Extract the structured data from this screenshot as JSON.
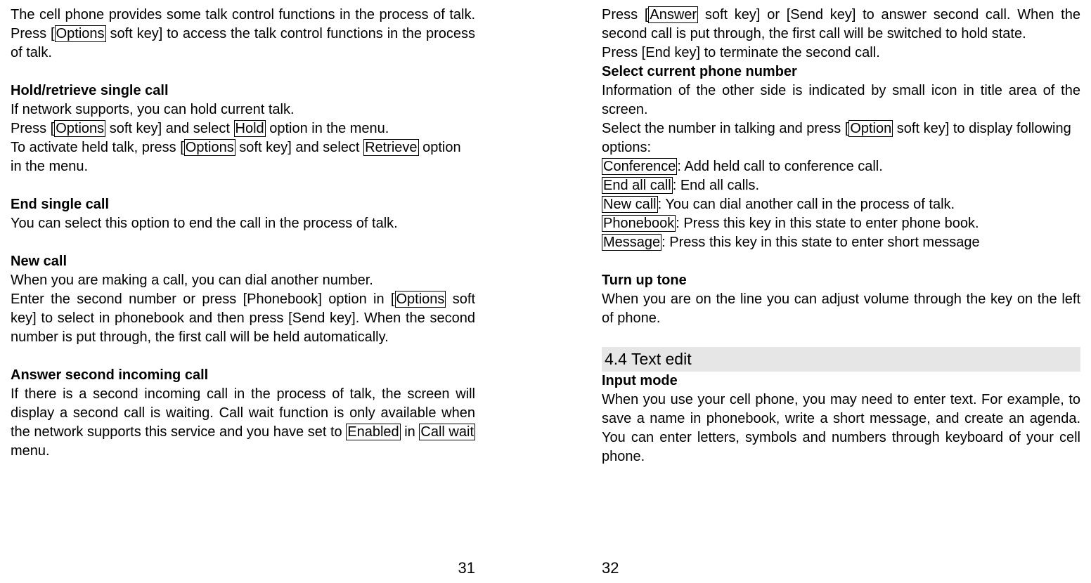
{
  "left": {
    "p1a": "The cell phone provides some talk control functions in the process of talk. Press [",
    "p1b": " soft key] to access the talk control functions in the process of talk.",
    "h1": "Hold/retrieve single call",
    "p2": "If network supports, you can hold current talk.",
    "p3a": "Press [",
    "p3b": " soft key] and select ",
    "p3c": " option in the menu.",
    "p4a": "To activate held talk, press [",
    "p4b": " soft key] and select ",
    "p4c": " option in the menu.",
    "h2": "End single call",
    "p5": "You can select this option to end the call in the process of talk.",
    "h3": "New call",
    "p6": "When you are making a call, you can dial another number.",
    "p7a": "Enter the second number or press [Phonebook] option in [",
    "p7b": " soft key] to select in phonebook and then press [Send key]. When the second number is put through, the first call will be held automatically.",
    "h4": "Answer second incoming call",
    "p8a": "If there is a second incoming call in the process of talk, the screen will display a second call is waiting. Call wait function is only available when the network supports this service and you have set to ",
    "p8b": " in ",
    "p8c": " menu.",
    "box_options": "Options",
    "box_hold": "Hold",
    "box_retrieve": "Retrieve",
    "box_enabled": "Enabled",
    "box_callwait": "Call wait",
    "pagenum": "31"
  },
  "right": {
    "p1a": "Press [",
    "p1b": " soft key] or [Send key] to answer second call. When the second call is put through, the first call will be switched to hold state.",
    "p2": "Press [End key] to terminate the second call.",
    "h1": "Select current phone number",
    "p3": "Information of the other side is indicated by small icon in title area of the screen.",
    "p4a": "Select the number in talking and press [",
    "p4b": " soft key] to display following options:",
    "opt1a": ": Add held call to conference call.",
    "opt2a": ": End all calls.",
    "opt3a": ": You can dial another call in the process of talk.",
    "opt4a": ": Press this key in this state to enter phone book.",
    "opt5a": ": Press this key in this state to enter short message",
    "h2": "Turn up tone",
    "p5": "When you are on the line you can adjust volume through the key on the left of phone.",
    "h3": "4.4 Text edit",
    "h4": "Input mode",
    "p6": "When you use your cell phone, you may need to enter text. For example, to save a name in phonebook, write a short message, and create an agenda. You can enter letters, symbols and numbers through keyboard of your cell phone.",
    "box_answer": "Answer",
    "box_option": "Option",
    "box_conference": "Conference",
    "box_endall": "End all call",
    "box_newcall": "New call",
    "box_phonebook": "Phonebook",
    "box_message": "Message",
    "pagenum": "32"
  }
}
